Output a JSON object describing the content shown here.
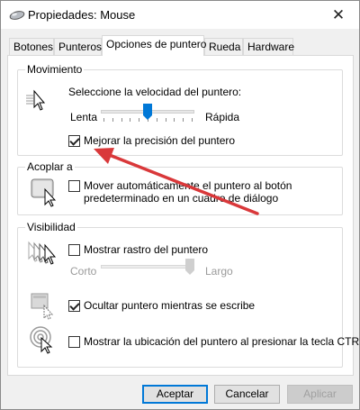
{
  "window": {
    "title": "Propiedades: Mouse"
  },
  "tabs": [
    {
      "label": "Botones"
    },
    {
      "label": "Punteros"
    },
    {
      "label": "Opciones de puntero"
    },
    {
      "label": "Rueda"
    },
    {
      "label": "Hardware"
    }
  ],
  "movimiento": {
    "title": "Movimiento",
    "speed_label": "Seleccione la velocidad del puntero:",
    "slow": "Lenta",
    "fast": "Rápida",
    "speed_level": 0.5,
    "precision_label": "Mejorar la precisión del puntero",
    "precision_checked": true
  },
  "acoplar": {
    "title": "Acoplar a",
    "snap_label_line1": "Mover automáticamente el puntero al botón",
    "snap_label_line2": "predeterminado en un cuadro de diálogo",
    "snap_checked": false
  },
  "visibilidad": {
    "title": "Visibilidad",
    "trails_label": "Mostrar rastro del puntero",
    "trails_checked": false,
    "short": "Corto",
    "long": "Largo",
    "hide_label": "Ocultar puntero mientras se escribe",
    "hide_checked": true,
    "ctrl_label": "Mostrar la ubicación del puntero al presionar la tecla CTRL",
    "ctrl_checked": false
  },
  "buttons": {
    "accept": "Aceptar",
    "cancel": "Cancelar",
    "apply": "Aplicar"
  },
  "colors": {
    "annotation_arrow": "#d9383a",
    "slider_thumb": "#0078d7"
  }
}
